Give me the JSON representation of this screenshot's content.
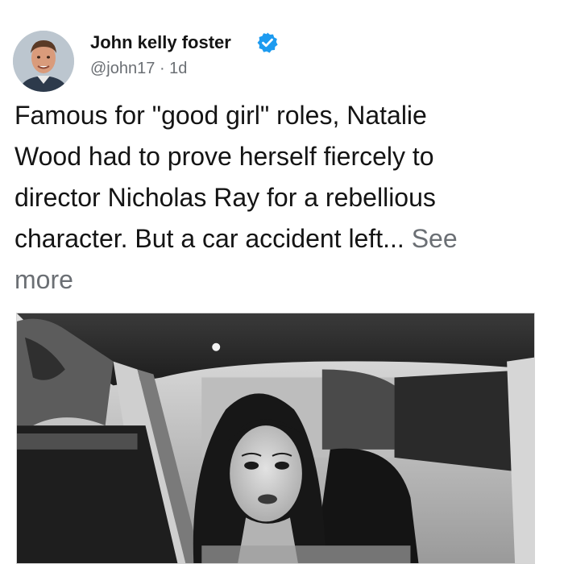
{
  "author": {
    "name": "John kelly foster",
    "handle": "@john17",
    "separator": "·",
    "time": "1d",
    "verified": true
  },
  "post": {
    "lines": [
      "Famous for \"good girl\" roles, Natalie",
      "Wood had to prove herself fiercely to",
      "director Nicholas Ray for a rebellious",
      "character. But a car accident left..."
    ],
    "see_more_1": "See",
    "see_more_2": "more"
  },
  "media": {
    "type": "photo",
    "description_icon": "black-and-white-photo-woman-in-car"
  },
  "colors": {
    "text": "#141414",
    "muted": "#6b6f74",
    "verified": "#1d9bf0"
  }
}
